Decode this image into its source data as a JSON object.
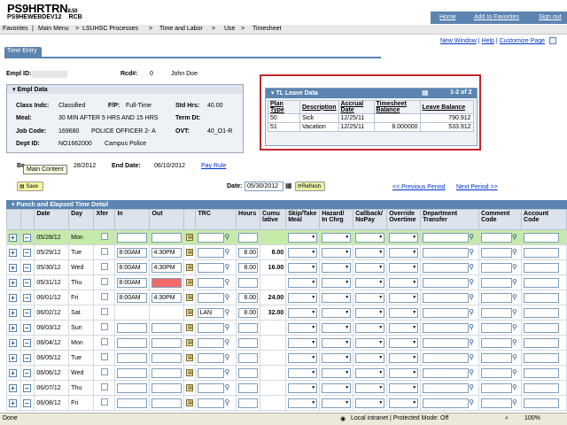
{
  "header": {
    "system_name": "PS9HRTRN",
    "version": "8.50",
    "db_name": "PS9HEWEBDEV12",
    "rcb": "RCB",
    "links": {
      "home": "Home",
      "favorites": "Add to Favorites",
      "signout": "Sign out"
    }
  },
  "breadcrumb": [
    "Favorites",
    "Main Menu",
    "LSUHSC Processes",
    "Time and Labor",
    "Use",
    "Timesheet"
  ],
  "actions": {
    "new_window": "New Window",
    "help": "Help",
    "customize": "Customize Page"
  },
  "tab": "Time Entry",
  "employee": {
    "empl_id_label": "Empl ID:",
    "rcd_label": "Rcd#:",
    "rcd_value": "0",
    "name": "John Doe",
    "section": "Empl Data",
    "class_indc_label": "Class Indc:",
    "class_indc": "Classified",
    "fp_label": "F/P:",
    "fp": "Full-Time",
    "std_hrs_label": "Std Hrs:",
    "std_hrs": "40.00",
    "meal_label": "Meal:",
    "meal": "30 MIN AFTER 5 HRS AND 15 HRS",
    "term_dt_label": "Term Dt:",
    "job_code_label": "Job Code:",
    "job_code": "169680",
    "job_title": "POLICE OFFICER 2- A",
    "ovt_label": "OVT:",
    "ovt": "40_O1-R",
    "dept_id_label": "Dept ID:",
    "dept_id": "NO1662000",
    "dept_name": "Campus Police"
  },
  "leave": {
    "title": "TL Leave Data",
    "pager": "1-2 of 2",
    "columns": [
      "Plan Type",
      "Description",
      "Accrual Date",
      "Timesheet Balance",
      "Leave Balance"
    ],
    "rows": [
      [
        "50",
        "Sick",
        "12/25/11",
        "",
        "790.912"
      ],
      [
        "51",
        "Vacation",
        "12/25/11",
        "8.000000",
        "533.912"
      ]
    ]
  },
  "period": {
    "begin_label": "Be",
    "begin_value": "28/2012",
    "tooltip": "Main Content",
    "end_label": "End Date:",
    "end_value": "06/10/2012",
    "pay_rule": "Pay Rule",
    "save": "Save",
    "date_label": "Date:",
    "date_value": "05/30/2012",
    "refresh": "Refresh",
    "prev": "<< Previous Period",
    "next": "Next Period >>"
  },
  "grid": {
    "title": "Punch and Elapsed Time Detail",
    "columns": [
      "",
      "",
      "Date",
      "Day",
      "Xfer",
      "In",
      "Out",
      "",
      "TRC",
      "Hours",
      "Cumu lative",
      "Skip/Take Meal",
      "Hazard/ In Chrg",
      "Callback/ NoPay",
      "Override Overtime",
      "Department Transfer",
      "Comment Code",
      "Account Code"
    ],
    "rows": [
      {
        "date": "05/28/12",
        "day": "Mon",
        "in": "",
        "out": "",
        "trc": "",
        "hours": "",
        "cum": "",
        "hl": true
      },
      {
        "date": "05/29/12",
        "day": "Tue",
        "in": "8:00AM",
        "out": "4:30PM",
        "trc": "",
        "hours": "8.00",
        "cum": "8.00"
      },
      {
        "date": "05/30/12",
        "day": "Wed",
        "in": "8:00AM",
        "out": "4:30PM",
        "trc": "",
        "hours": "8.00",
        "cum": "16.00"
      },
      {
        "date": "05/31/12",
        "day": "Thu",
        "in": "8:00AM",
        "out": "",
        "trc": "",
        "hours": "",
        "cum": "",
        "red": true
      },
      {
        "date": "06/01/12",
        "day": "Fri",
        "in": "8:00AM",
        "out": "4:30PM",
        "trc": "",
        "hours": "8.00",
        "cum": "24.00"
      },
      {
        "date": "06/02/12",
        "day": "Sat",
        "in": "",
        "out": "",
        "trc": "LAN",
        "hours": "8.00",
        "cum": "32.00",
        "noin": true
      },
      {
        "date": "06/03/12",
        "day": "Sun",
        "in": "",
        "out": "",
        "trc": "",
        "hours": "",
        "cum": ""
      },
      {
        "date": "06/04/12",
        "day": "Mon",
        "in": "",
        "out": "",
        "trc": "",
        "hours": "",
        "cum": ""
      },
      {
        "date": "06/05/12",
        "day": "Tue",
        "in": "",
        "out": "",
        "trc": "",
        "hours": "",
        "cum": ""
      },
      {
        "date": "06/06/12",
        "day": "Wed",
        "in": "",
        "out": "",
        "trc": "",
        "hours": "",
        "cum": ""
      },
      {
        "date": "06/07/12",
        "day": "Thu",
        "in": "",
        "out": "",
        "trc": "",
        "hours": "",
        "cum": ""
      },
      {
        "date": "06/08/12",
        "day": "Fri",
        "in": "",
        "out": "",
        "trc": "",
        "hours": "",
        "cum": ""
      }
    ]
  },
  "statusbar": {
    "left": "Done",
    "zone": "Local intranet | Protected Mode: Off",
    "zoom": "100%"
  }
}
